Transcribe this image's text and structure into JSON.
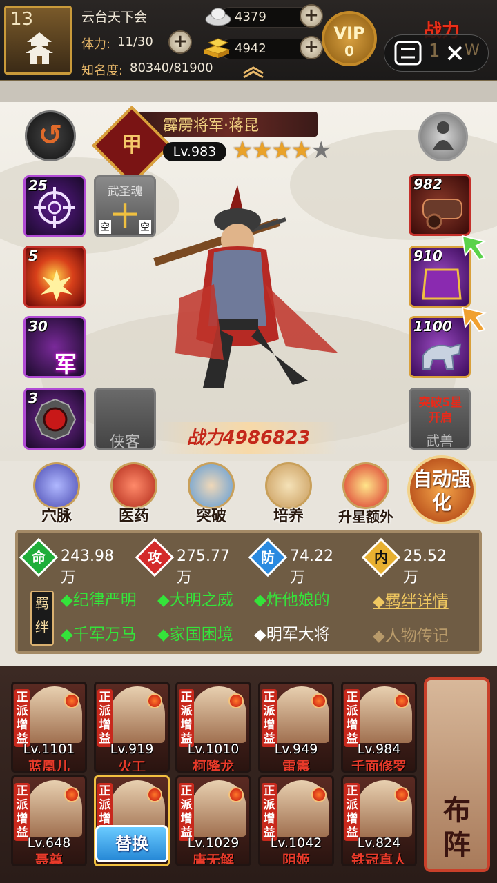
{
  "top_bar": {
    "player_level": "13",
    "player_name": "云台天下会",
    "stamina_label": "体力:",
    "stamina_value": "11/30",
    "fame_label": "知名度:",
    "fame_value": "80340/81900",
    "silver": "4379",
    "gold": "4942",
    "vip_label": "VIP",
    "vip_level": "0",
    "power_label": "战力",
    "power_partial": "1",
    "power_partial_suffix": "W"
  },
  "hero": {
    "name": "霹雳将军·蒋昆",
    "quality": "甲",
    "level": "Lv.983",
    "stars_filled": 4,
    "stars_total": 5,
    "power": "战力4986823"
  },
  "left_slots": [
    {
      "count": "25"
    },
    {
      "count": "5"
    },
    {
      "count": "30",
      "glyph": "军"
    },
    {
      "count": "3"
    }
  ],
  "wusheng": {
    "title": "武圣魂",
    "glyph": "十",
    "empty_left": "空",
    "empty_right": "空"
  },
  "xiake_label": "侠客",
  "right_slots": [
    {
      "count": "982"
    },
    {
      "count": "910"
    },
    {
      "count": "1100"
    }
  ],
  "wushou": {
    "unlock_text": "突破5星开启",
    "label": "武兽"
  },
  "functions": [
    "穴脉",
    "医药",
    "突破",
    "培养",
    "升星额外"
  ],
  "auto_button": "自动强化",
  "stats": [
    {
      "icon": "命",
      "value": "243.98万",
      "color": "#1fae3a"
    },
    {
      "icon": "攻",
      "value": "275.77万",
      "color": "#d42a2a"
    },
    {
      "icon": "防",
      "value": "74.22万",
      "color": "#2a8ae0"
    },
    {
      "icon": "内",
      "value": "25.52万",
      "color": "#e8b030"
    }
  ],
  "jiban_label": "羁绊",
  "fetters": [
    {
      "text": "◆纪律严明",
      "active": true
    },
    {
      "text": "◆大明之威",
      "active": true
    },
    {
      "text": "◆炸他娘的",
      "active": true
    },
    {
      "text": "◆千军万马",
      "active": true
    },
    {
      "text": "◆家国困境",
      "active": true
    },
    {
      "text": "◆明军大将",
      "active": false
    }
  ],
  "links": {
    "fetter_detail": "◆羁绊详情",
    "biography": "◆人物传记"
  },
  "roster_tag": "正派增益",
  "roster": [
    {
      "level": "Lv.1101",
      "name": "蓝凰儿"
    },
    {
      "level": "Lv.919",
      "name": "火工"
    },
    {
      "level": "Lv.1010",
      "name": "柯降龙"
    },
    {
      "level": "Lv.949",
      "name": "雷震"
    },
    {
      "level": "Lv.984",
      "name": "千面修罗"
    },
    {
      "level": "Lv.648",
      "name": "聂尊"
    },
    {
      "level": "",
      "name": ""
    },
    {
      "level": "Lv.1029",
      "name": "唐无解"
    },
    {
      "level": "Lv.1042",
      "name": "阴姬"
    },
    {
      "level": "Lv.824",
      "name": "铁冠真人"
    }
  ],
  "replace_button": "替换",
  "formation_button": "布阵"
}
